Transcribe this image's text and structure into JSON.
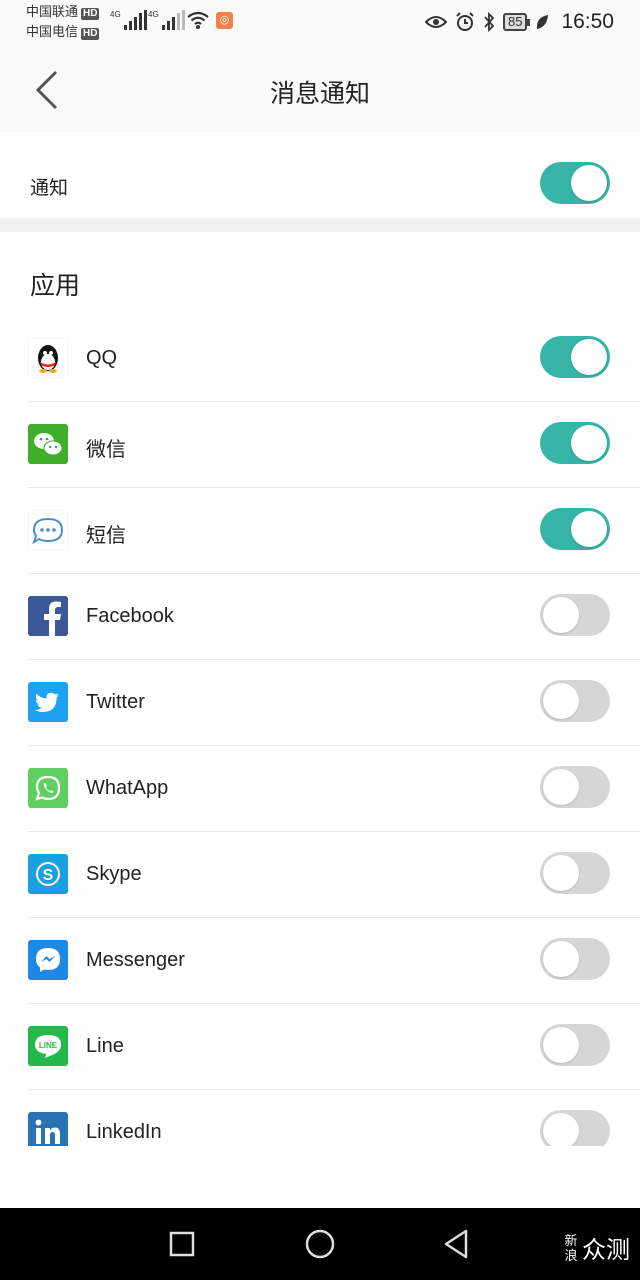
{
  "status_bar": {
    "carrier1": "中国联通",
    "carrier2": "中国电信",
    "hd": "HD",
    "net_label": "4G",
    "battery": "85",
    "time": "16:50"
  },
  "header": {
    "title": "消息通知"
  },
  "notification": {
    "label": "通知",
    "enabled": true
  },
  "apps_section": {
    "title": "应用"
  },
  "apps": [
    {
      "name": "QQ",
      "icon": "qq-icon",
      "enabled": true
    },
    {
      "name": "微信",
      "icon": "wechat-icon",
      "enabled": true
    },
    {
      "name": "短信",
      "icon": "sms-icon",
      "enabled": true
    },
    {
      "name": "Facebook",
      "icon": "facebook-icon",
      "enabled": false
    },
    {
      "name": "Twitter",
      "icon": "twitter-icon",
      "enabled": false
    },
    {
      "name": "WhatApp",
      "icon": "whatsapp-icon",
      "enabled": false
    },
    {
      "name": "Skype",
      "icon": "skype-icon",
      "enabled": false
    },
    {
      "name": "Messenger",
      "icon": "messenger-icon",
      "enabled": false
    },
    {
      "name": "Line",
      "icon": "line-icon",
      "enabled": false
    },
    {
      "name": "LinkedIn",
      "icon": "linkedin-icon",
      "enabled": false
    }
  ],
  "colors": {
    "toggle_on": "#36b4a6",
    "toggle_off": "#d6d6d6"
  },
  "watermark": {
    "small": "新浪",
    "large": "众测"
  }
}
